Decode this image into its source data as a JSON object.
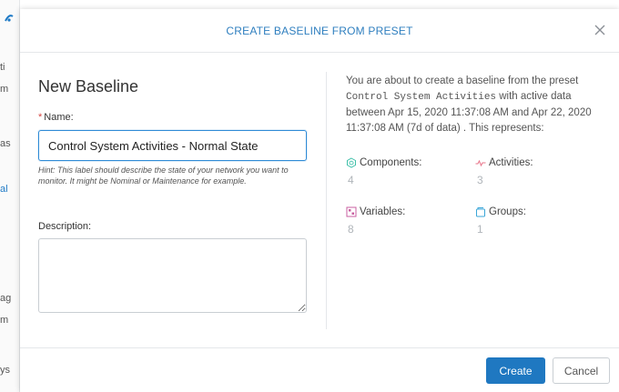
{
  "background": {
    "fragments": [
      "ti",
      "m",
      "as",
      "al",
      "ag",
      "m",
      "ys"
    ]
  },
  "modal": {
    "title": "CREATE BASELINE FROM PRESET",
    "close_icon": "close-icon",
    "form": {
      "heading": "New Baseline",
      "required_marker": "*",
      "name_label": "Name:",
      "name_value": "Control System Activities - Normal State",
      "hint": "Hint: This label should describe the state of your network you want to monitor. It might be Nominal or Maintenance for example.",
      "description_label": "Description:",
      "description_value": ""
    },
    "summary": {
      "intro": "You are about to create a baseline from the preset",
      "preset": "Control System Activities",
      "middle": "with active data between Apr 15, 2020 11:37:08 AM and Apr 22, 2020 11:37:08 AM (7d of data) . This represents:",
      "stats": [
        {
          "label": "Components:",
          "value": "4",
          "icon": "components-icon",
          "color": "#3dbfa8"
        },
        {
          "label": "Activities:",
          "value": "3",
          "icon": "activities-icon",
          "color": "#e8758a"
        },
        {
          "label": "Variables:",
          "value": "8",
          "icon": "variables-icon",
          "color": "#c95fa0"
        },
        {
          "label": "Groups:",
          "value": "1",
          "icon": "groups-icon",
          "color": "#3aa6d8"
        }
      ]
    },
    "footer": {
      "create_label": "Create",
      "cancel_label": "Cancel"
    }
  },
  "colors": {
    "accent": "#1f78c1",
    "title": "#2f7fbf",
    "focus_border": "#2f8bd6"
  }
}
